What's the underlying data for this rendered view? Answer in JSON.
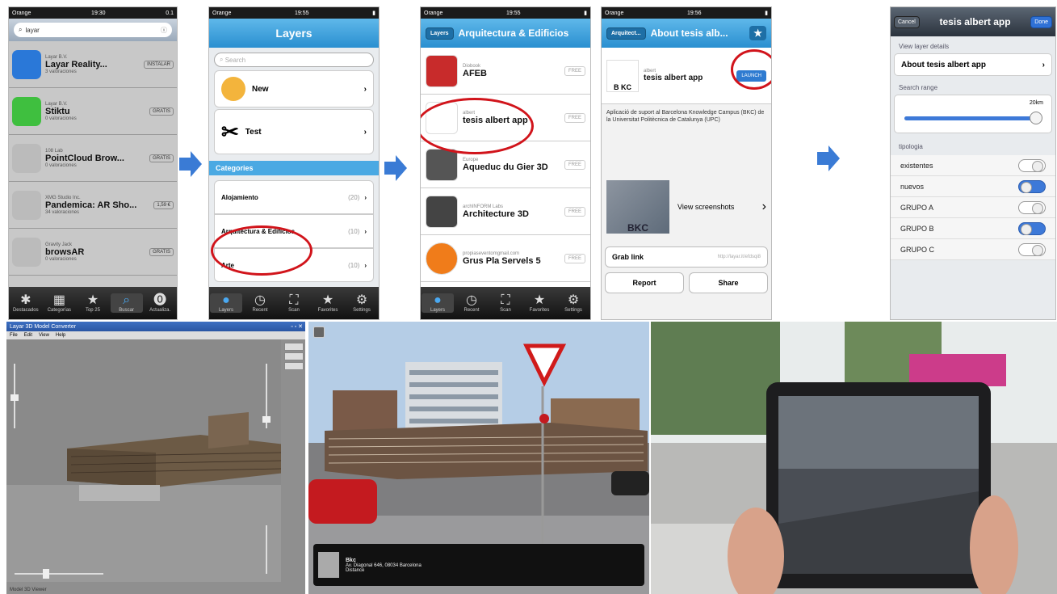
{
  "app_store": {
    "status": {
      "carrier": "Orange",
      "net": "3G",
      "time": "19:30",
      "battery": "0.1"
    },
    "search_value": "layar",
    "apps": [
      {
        "dev": "Layar B.V.",
        "name": "Layar Reality...",
        "price": "INSTALAR",
        "sub": "3 valoraciones",
        "color": "#2a78d8"
      },
      {
        "dev": "Layar B.V.",
        "name": "Stiktu",
        "price": "GRATIS",
        "sub": "0 valoraciones",
        "color": "#3fbf3f"
      },
      {
        "dev": "108 Lab",
        "name": "PointCloud Brow...",
        "price": "GRATIS",
        "sub": "0 valoraciones",
        "color": "#bbbbbb"
      },
      {
        "dev": "XMG Studio Inc.",
        "name": "Pandemica: AR Sho...",
        "price": "1,59 €",
        "sub": "34 valoraciones",
        "color": "#bbbbbb"
      },
      {
        "dev": "Gravity Jack",
        "name": "browsAR",
        "price": "GRATIS",
        "sub": "0 valoraciones",
        "color": "#bbbbbb"
      }
    ],
    "tabs": [
      "Destacados",
      "Categorías",
      "Top 25",
      "Buscar",
      "Actualiza."
    ]
  },
  "layers": {
    "status": {
      "carrier": "Orange",
      "net": "3G",
      "time": "19:55"
    },
    "title": "Layers",
    "search_placeholder": "Search",
    "items": [
      "New",
      "Test"
    ],
    "section": "Categories",
    "categories": [
      {
        "label": "Alojamiento",
        "count": "(20)"
      },
      {
        "label": "Arquitectura & Edificios",
        "count": "(10)"
      },
      {
        "label": "Arte",
        "count": "(10)"
      }
    ],
    "tabs": [
      "Layers",
      "Recent",
      "Scan",
      "Favorites",
      "Settings"
    ]
  },
  "category": {
    "status": {
      "carrier": "Orange",
      "net": "3G",
      "time": "19:55"
    },
    "back": "Layers",
    "title": "Arquitectura & Edificios",
    "rows": [
      {
        "dev": "Diobook",
        "name": "AFEB",
        "btn": "FREE"
      },
      {
        "dev": "albert",
        "name": "tesis albert app",
        "btn": "FREE"
      },
      {
        "dev": "Europe",
        "name": "Aqueduc du Gier 3D",
        "btn": "FREE"
      },
      {
        "dev": "archINFORM Labs",
        "name": "Architecture 3D",
        "btn": "FREE"
      },
      {
        "dev": "propiaseventomgmail.com",
        "name": "Grus Pla Servels 5",
        "btn": "FREE"
      }
    ],
    "tabs": [
      "Layers",
      "Recent",
      "Scan",
      "Favorites",
      "Settings"
    ]
  },
  "about": {
    "status": {
      "carrier": "Orange",
      "net": "3G",
      "time": "19:56"
    },
    "back": "Arquitect...",
    "title": "About tesis alb...",
    "dev": "albert",
    "name": "tesis albert app",
    "launch": "LAUNCH",
    "logo": "B KC",
    "description": "Aplicació de suport al Barcelona Knowledge Campus (BKC) de la Universitat Politècnica de Catalunya (UPC)",
    "screenshots": "View screenshots",
    "grab_label": "Grab link",
    "grab_value": "http://layar.it/efdsqi8",
    "report": "Report",
    "share": "Share"
  },
  "settings": {
    "cancel": "Cancel",
    "title": "tesis albert app",
    "done": "Done",
    "header1": "View layer details",
    "about_row": "About tesis albert app",
    "header2": "Search range",
    "range_value": "20km",
    "range_fraction": 0.97,
    "header3": "tipologia",
    "toggles": [
      {
        "label": "existentes",
        "on": false
      },
      {
        "label": "nuevos",
        "on": true
      },
      {
        "label": "GRUPO A",
        "on": false
      },
      {
        "label": "GRUPO B",
        "on": true
      },
      {
        "label": "GRUPO C",
        "on": false
      }
    ]
  },
  "modeler": {
    "title": "Layar 3D Model Converter",
    "menu": [
      "File",
      "Edit",
      "View",
      "Help"
    ],
    "footer": "Model 3D Viewer"
  },
  "ar_view": {
    "caption_title": "Bkc",
    "caption_line1": "Av. Diagonal 646, 08034 Barcelona",
    "caption_line2": "Distance"
  },
  "colors": {
    "nav_blue": "#2a8fd0",
    "arrow_blue": "#3a7bd5",
    "ring_red": "#d1141b"
  }
}
